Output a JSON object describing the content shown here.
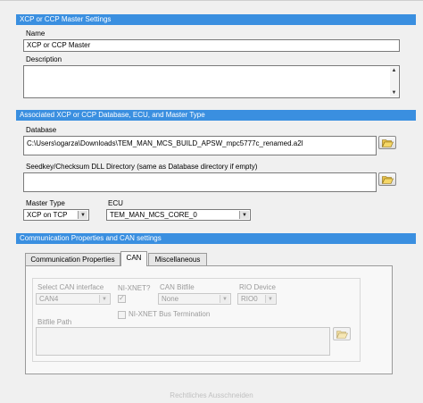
{
  "master_settings": {
    "title": "XCP or CCP Master Settings",
    "name_label": "Name",
    "name_value": "XCP or CCP Master",
    "description_label": "Description",
    "description_value": ""
  },
  "database_section": {
    "title": "Associated XCP or CCP Database, ECU, and Master Type",
    "database_label": "Database",
    "database_value": "C:\\Users\\ogarza\\Downloads\\TEM_MAN_MCS_BUILD_APSW_mpc5777c_renamed.a2l",
    "seedkey_label": "Seedkey/Checksum DLL Directory (same as Database directory if empty)",
    "seedkey_value": "",
    "master_type_label": "Master Type",
    "master_type_value": "XCP on TCP",
    "ecu_label": "ECU",
    "ecu_value": "TEM_MAN_MCS_CORE_0"
  },
  "comm_section": {
    "title": "Communication Properties and CAN settings",
    "tabs": [
      {
        "label": "Communication Properties"
      },
      {
        "label": "CAN"
      },
      {
        "label": "Miscellaneous"
      }
    ],
    "active_tab": "CAN",
    "can": {
      "interface_label": "Select CAN interface",
      "interface_value": "CAN4",
      "nixnet_label": "NI-XNET?",
      "nixnet_checked": true,
      "bitfile_label": "CAN Bitfile",
      "bitfile_value": "None",
      "rio_label": "RIO Device",
      "rio_value": "RIO0",
      "termination_label": "NI-XNET Bus Termination",
      "termination_checked": false,
      "bitfile_path_label": "Bitfile Path",
      "bitfile_path_value": ""
    }
  },
  "footer": {
    "text": "Rechtliches Ausschneiden"
  },
  "colors": {
    "section_bar": "#3a8fe0",
    "window_bg": "#f0f0f0"
  },
  "icons": {
    "browse": "folder-open-icon",
    "dropdown": "chevron-down-icon"
  }
}
